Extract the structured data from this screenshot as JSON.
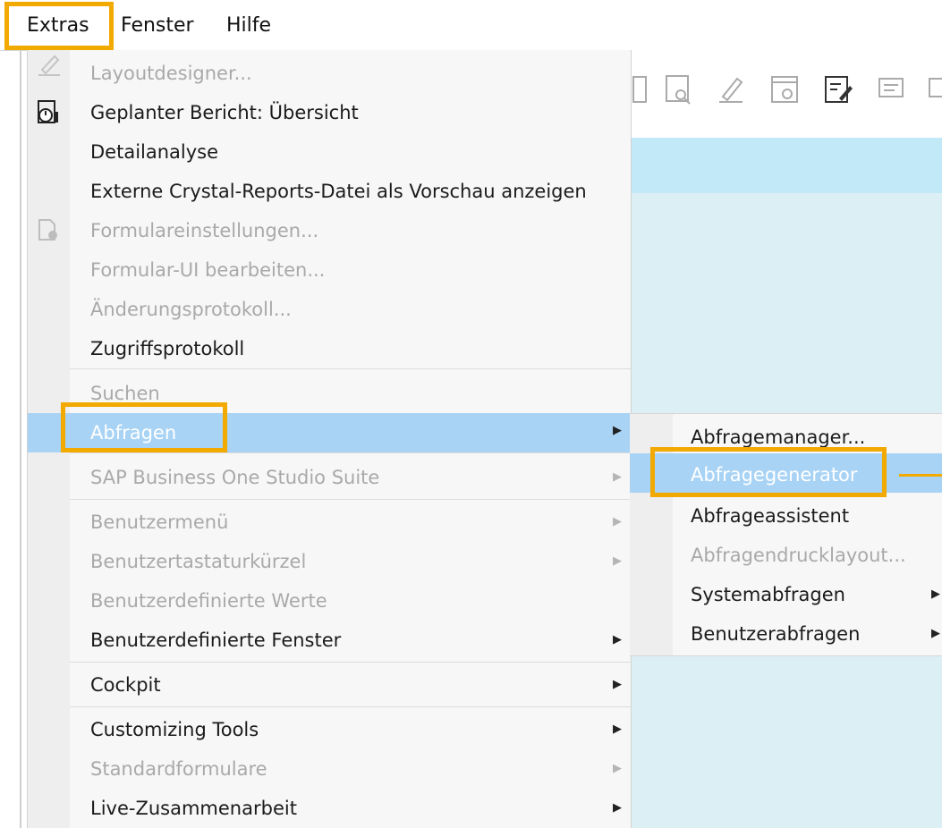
{
  "menubar": {
    "items": [
      {
        "label": "Extras"
      },
      {
        "label": "Fenster"
      },
      {
        "label": "Hilfe"
      }
    ]
  },
  "extras_menu": {
    "items": [
      {
        "label": "Layoutdesigner...",
        "enabled": false
      },
      {
        "label": "Geplanter Bericht: Übersicht",
        "enabled": true
      },
      {
        "label": "Detailanalyse",
        "enabled": true
      },
      {
        "label": "Externe Crystal-Reports-Datei als Vorschau anzeigen",
        "enabled": true
      },
      {
        "label": "Formulareinstellungen...",
        "enabled": false
      },
      {
        "label": "Formular-UI bearbeiten...",
        "enabled": false
      },
      {
        "label": "Änderungsprotokoll...",
        "enabled": false
      },
      {
        "label": "Zugriffsprotokoll",
        "enabled": true
      },
      {
        "label": "Suchen",
        "enabled": false
      },
      {
        "label": "Abfragen",
        "enabled": true,
        "selected": true,
        "submenu": true
      },
      {
        "label": "SAP Business One Studio Suite",
        "enabled": false,
        "submenu": true
      },
      {
        "label": "Benutzermenü",
        "enabled": false,
        "submenu": true
      },
      {
        "label": "Benutzertastaturkürzel",
        "enabled": false,
        "submenu": true
      },
      {
        "label": "Benutzerdefinierte Werte",
        "enabled": false
      },
      {
        "label": "Benutzerdefinierte Fenster",
        "enabled": true,
        "submenu": true
      },
      {
        "label": "Cockpit",
        "enabled": true,
        "submenu": true
      },
      {
        "label": "Customizing Tools",
        "enabled": true,
        "submenu": true
      },
      {
        "label": "Standardformulare",
        "enabled": false,
        "submenu": true
      },
      {
        "label": "Live-Zusammenarbeit",
        "enabled": true,
        "submenu": true
      }
    ]
  },
  "abfragen_submenu": {
    "items": [
      {
        "label": "Abfragemanager...",
        "enabled": true
      },
      {
        "label": "Abfragegenerator",
        "enabled": true,
        "selected": true
      },
      {
        "label": "Abfrageassistent",
        "enabled": true
      },
      {
        "label": "Abfragendrucklayout...",
        "enabled": false
      },
      {
        "label": "Systemabfragen",
        "enabled": true,
        "submenu": true
      },
      {
        "label": "Benutzerabfragen",
        "enabled": true,
        "submenu": true
      }
    ]
  },
  "icons": {
    "layoutdesigner": "pencil-icon",
    "geplanter_bericht": "scheduled-report-icon",
    "formulareinstellungen": "form-settings-icon",
    "submenu_arrow": "chevron-right-icon"
  },
  "colors": {
    "highlight": "#f2a900",
    "selection": "#a8d3f5",
    "menu_bg": "#f7f7f7",
    "disabled_text": "#a9a9a9",
    "content_blue": "#dceff5"
  },
  "glyphs": {
    "arrow": "▶"
  }
}
